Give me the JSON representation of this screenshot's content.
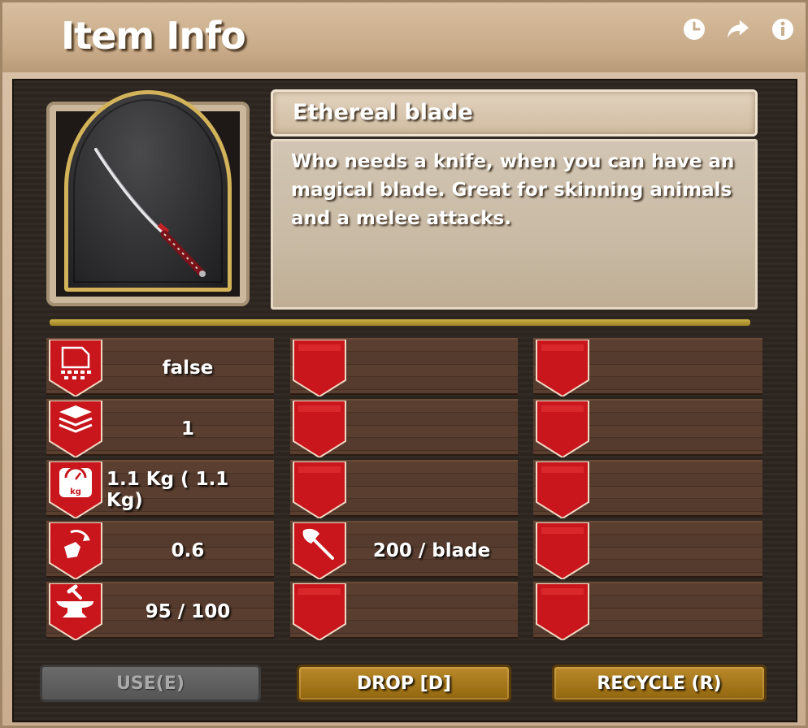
{
  "window": {
    "title": "Item Info"
  },
  "header_icons": [
    "clock-icon",
    "share-arrow-icon",
    "info-icon"
  ],
  "item": {
    "name": "Ethereal blade",
    "description": "Who needs a knife, when you can have an magical blade. Great for skinning animals and a melee attacks.",
    "image_icon": "katana-sword-icon"
  },
  "stats": {
    "col1": [
      {
        "icon": "shredder-icon",
        "value": "false"
      },
      {
        "icon": "stack-layers-icon",
        "value": "1"
      },
      {
        "icon": "weight-scale-icon",
        "value": "1.1 Kg ( 1.1 Kg)"
      },
      {
        "icon": "swing-speed-icon",
        "value": "0.6"
      },
      {
        "icon": "anvil-icon",
        "value": "95 / 100"
      }
    ],
    "col2": [
      {
        "icon": "empty-badge",
        "value": ""
      },
      {
        "icon": "empty-badge",
        "value": ""
      },
      {
        "icon": "empty-badge",
        "value": ""
      },
      {
        "icon": "axe-icon",
        "value": "200 / blade"
      },
      {
        "icon": "empty-badge",
        "value": ""
      }
    ],
    "col3": [
      {
        "icon": "empty-badge",
        "value": ""
      },
      {
        "icon": "empty-badge",
        "value": ""
      },
      {
        "icon": "empty-badge",
        "value": ""
      },
      {
        "icon": "empty-badge",
        "value": ""
      },
      {
        "icon": "empty-badge",
        "value": ""
      }
    ]
  },
  "buttons": {
    "use": "USE(E)",
    "drop": "DROP [D]",
    "recycle": "RECYCLE (R)"
  },
  "colors": {
    "badge_red": "#c8161c",
    "gold_divider": "#c4a63e",
    "button_gold": "#a5761d"
  }
}
